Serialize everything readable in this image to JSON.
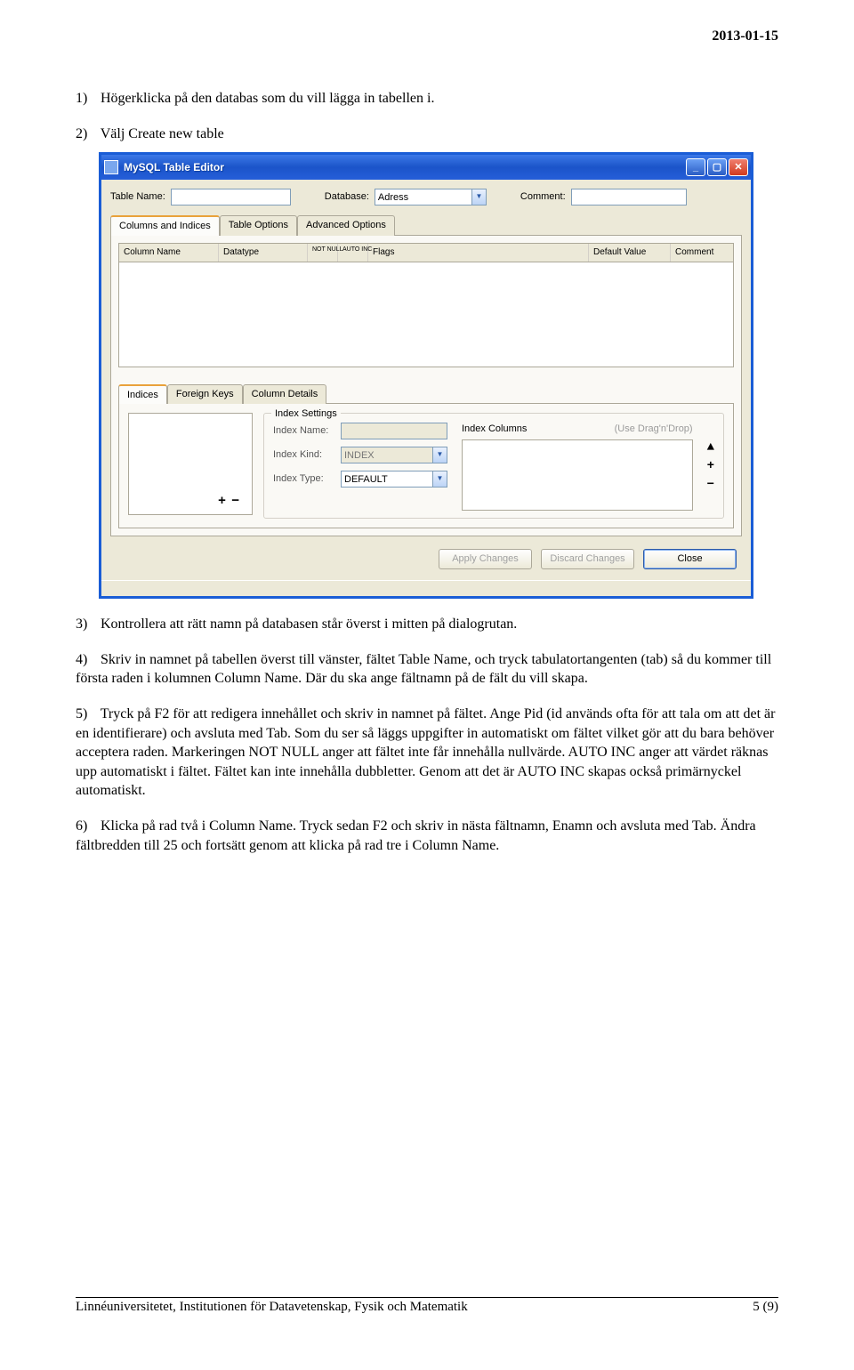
{
  "header_date": "2013-01-15",
  "items": {
    "n1": "1)",
    "t1": "Högerklicka på den databas som du vill lägga in tabellen i.",
    "n2": "2)",
    "t2": "Välj Create new table",
    "n3": "3)",
    "t3": "Kontrollera att rätt namn på databasen står överst i mitten på dialogrutan.",
    "n4": "4)",
    "t4": "Skriv in namnet på tabellen överst till vänster, fältet Table Name, och tryck tabulatortangenten (tab) så du kommer till första raden i kolumnen Column Name. Där du ska ange fältnamn på de fält du vill skapa.",
    "n5": "5)",
    "t5": "Tryck på F2 för att redigera innehållet och skriv in namnet på fältet. Ange Pid (id används ofta för att tala om att det är en identifierare) och avsluta med Tab. Som du ser så läggs uppgifter in automatiskt om fältet vilket gör att du bara behöver acceptera raden. Markeringen NOT NULL anger att fältet inte får innehålla nullvärde. AUTO INC anger att värdet räknas upp automatiskt i fältet. Fältet kan inte innehålla dubbletter. Genom att det är AUTO INC skapas också primärnyckel automatiskt.",
    "n6": "6)",
    "t6": "Klicka på rad två i Column Name. Tryck sedan F2 och skriv in nästa fältnamn, Enamn och avsluta med Tab. Ändra fältbredden till 25 och fortsätt genom att klicka på rad tre i Column Name."
  },
  "app": {
    "title": "MySQL Table Editor",
    "labels": {
      "table_name": "Table Name:",
      "database": "Database:",
      "comment": "Comment:",
      "database_value": "Adress"
    },
    "tabs": {
      "cols": "Columns and Indices",
      "topts": "Table Options",
      "adv": "Advanced Options"
    },
    "col_headers": {
      "cname": "Column Name",
      "dtype": "Datatype",
      "nn": "NOT\nNULL",
      "ai": "AUTO\nINC",
      "flags": "Flags",
      "defv": "Default Value",
      "cc": "Comment"
    },
    "subtabs": {
      "idx": "Indices",
      "fk": "Foreign Keys",
      "cd": "Column Details"
    },
    "idx": {
      "grp": "Index Settings",
      "name": "Index Name:",
      "kind": "Index Kind:",
      "kind_v": "INDEX",
      "type": "Index Type:",
      "type_v": "DEFAULT",
      "cols": "Index Columns",
      "hint": "(Use Drag'n'Drop)"
    },
    "buttons": {
      "apply": "Apply Changes",
      "discard": "Discard Changes",
      "close": "Close"
    }
  },
  "footer": {
    "left": "Linnéuniversitetet, Institutionen för Datavetenskap, Fysik och Matematik",
    "right": "5 (9)"
  }
}
